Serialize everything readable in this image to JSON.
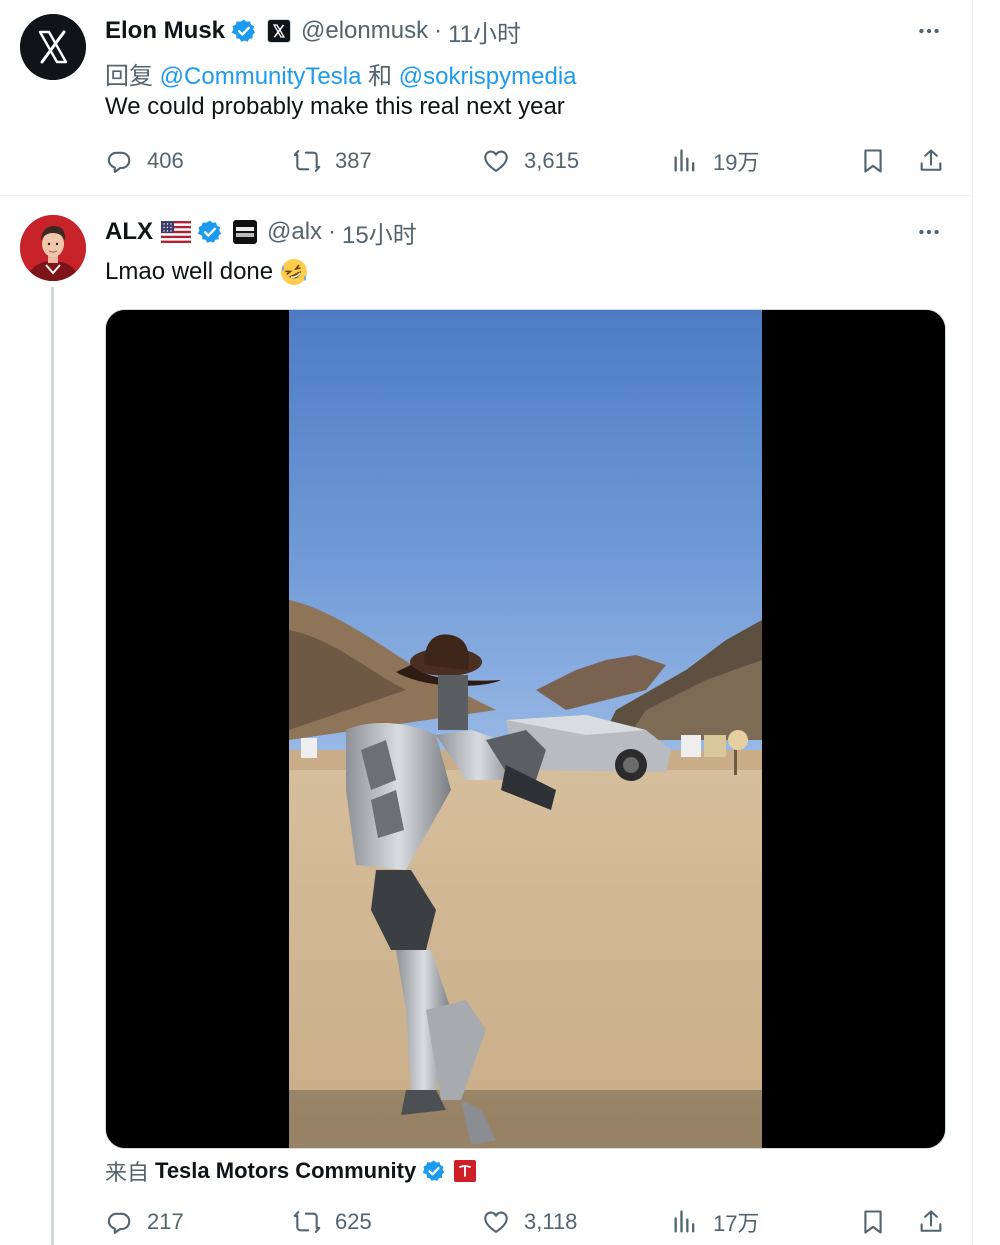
{
  "tweet1": {
    "author_name": "Elon Musk",
    "handle": "@elonmusk",
    "time": "11小时",
    "reply_prefix": "回复",
    "mention1": "@CommunityTesla",
    "joiner": "和",
    "mention2": "@sokrispymedia",
    "text": "We could probably make this real next year",
    "stats": {
      "replies": "406",
      "reposts": "387",
      "likes": "3,615",
      "views": "19万"
    }
  },
  "tweet2": {
    "author_name": "ALX",
    "handle": "@alx",
    "time": "15小时",
    "text": "Lmao well done",
    "source_prefix": "来自",
    "source_name": "Tesla Motors Community",
    "stats": {
      "replies": "217",
      "reposts": "625",
      "likes": "3,118",
      "views": "17万"
    }
  },
  "separator": "·",
  "icons": {
    "verified": "verified-badge-icon",
    "more": "more-options-icon",
    "reply": "reply-icon",
    "repost": "repost-icon",
    "like": "like-icon",
    "views": "views-icon",
    "bookmark": "bookmark-icon",
    "share": "share-icon"
  },
  "colors": {
    "accent": "#1d9bf0",
    "text": "#0f1419",
    "muted": "#536471",
    "border": "#eff3f4"
  }
}
